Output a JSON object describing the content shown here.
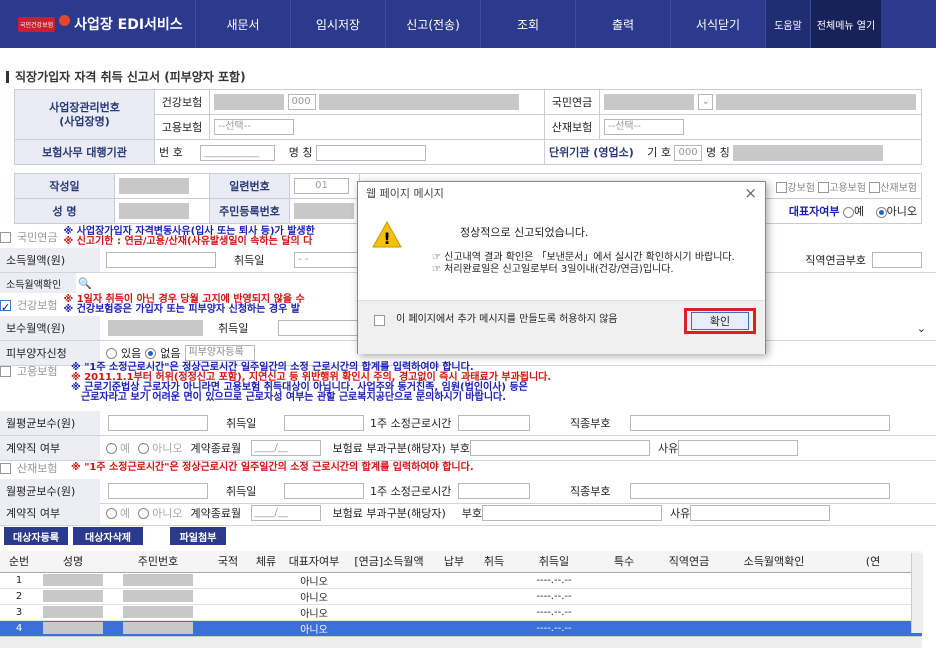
{
  "nav": {
    "logo_badge": "국민건강보험",
    "app_title": "사업장 EDI서비스",
    "menus": [
      "새문서",
      "임시저장",
      "신고(전송)",
      "조회",
      "출력",
      "서식닫기"
    ],
    "help": "도움말",
    "all_menu": "전체메뉴 열기"
  },
  "page_title": "직장가입자 자격 취득 신고서 (피부양자 포함)",
  "form": {
    "biz_no_label": "사업장관리번호\n(사업장명)",
    "health": "건강보험",
    "employ": "고용보험",
    "pension": "국민연금",
    "accident": "산재보험",
    "code_000": "000",
    "select_placeholder": "--선택--",
    "agency_label": "보험사무 대행기관",
    "num_label": "번 호",
    "name_label": "명 칭",
    "unit_label": "단위기관 (영업소)",
    "symbol_label": "기 호",
    "dash_line": "___________",
    "write_date": "작성일",
    "serial_no": "일련번호",
    "serial_val": "01",
    "name": "성 명",
    "resident_no": "주민등록번호",
    "rep_label": "대표자여부",
    "yes": "예",
    "no": "아니오",
    "partial_label_health": "강보험",
    "employ_chk": "고용보험",
    "accident_chk": "산재보험"
  },
  "pension_section": {
    "title": "국민연금",
    "note1": "※ 사업장가입자 자격변동사유(입사 또는 퇴사 등)가 발생한",
    "note2": "※ 신고기한 : 연금/고용/산재(사유발생일이 속하는 달의 다",
    "income_label": "소득월액(원)",
    "acq_date": "취득일",
    "dashes": "- -",
    "pension_code": "직역연금부호",
    "income_confirm": "소득월액확인"
  },
  "health_section": {
    "title": "건강보험",
    "note1": "※ 1일자 취득이 아닌 경우 당월 고지에 반영되지 않을 수",
    "note2": "※ 건강보험증은 가입자 또는 피부양자 신청하는 경우 발",
    "pay_label": "보수월액(원)",
    "acq_date": "취득일",
    "dependent_label": "피부양자신청",
    "has": "있음",
    "none": "없음",
    "dependent_btn": "피부양자등록"
  },
  "employ_section": {
    "title": "고용보험",
    "note1": "※ \"1주 소정근로시간\"은 정상근로시간 일주일간의  소정  근로시간의 합계를 입력하여야 합니다.",
    "note2": "※ 2011.1.1부터 허위(정정신고 포함), 지연신고 등 위반행위 확인시 주의, 경고없이 즉시 과태료가 부과됩니다.",
    "note3": "※ 근로기준법상 근로자가 아니라면 고용보험 취득대상이 아닙니다. 사업주와 동거친족, 임원(법인이사) 등은",
    "note4": "근로자라고 보기 어려운 면이 있으므로 근로자성 여부는 관할 근로복지공단으로 문의하시기 바랍니다.",
    "avg_pay": "월평균보수(원)",
    "acq_date": "취득일",
    "hours": "1주 소정근로시간",
    "job_code": "직종부호",
    "contract": "계약직 여부",
    "yes": "예",
    "no": "아니오",
    "contract_end": "계약종료월",
    "date_ph": "____/__",
    "exempt": "보험료 부과구분(해당자)",
    "code": "부호",
    "reason": "사유"
  },
  "accident_section": {
    "title": "산재보험",
    "note1": "※ \"1주 소정근로시간\"은 정상근로시간 일주일간의  소정  근로시간의 합계를 입력하여야 합니다.",
    "avg_pay": "월평균보수(원)",
    "acq_date": "취득일",
    "hours": "1주 소정근로시간",
    "job_code": "직종부호",
    "contract": "계약직 여부",
    "yes": "예",
    "no": "아니오",
    "contract_end": "계약종료월",
    "exempt": "보험료 부과구분(해당자)",
    "code": "부호",
    "reason": "사유"
  },
  "buttons": {
    "register": "대상자등록",
    "delete": "대상자삭제",
    "attach": "파일첨부"
  },
  "grid": {
    "columns": [
      "순번",
      "성명",
      "주민번호",
      "국적",
      "체류",
      "대표자여부",
      "[연금]소득월액",
      "납부",
      "취득",
      "취득일",
      "특수",
      "직역연금",
      "소득월액확인",
      "(연"
    ],
    "rows": [
      {
        "no": "1",
        "rep": "아니오",
        "date": "----.--.--"
      },
      {
        "no": "2",
        "rep": "아니오",
        "date": "----.--.--"
      },
      {
        "no": "3",
        "rep": "아니오",
        "date": "----.--.--"
      },
      {
        "no": "4",
        "rep": "아니오",
        "date": "----.--.--"
      }
    ]
  },
  "dialog": {
    "title": "웹 페이지 메시지",
    "close": "×",
    "message": "정상적으로 신고되었습니다.",
    "info1": "☞ 신고내역 결과 확인은 「보낸문서」에서 실시간 확인하시기 바랍니다.",
    "info2": "☞ 처리완료일은 신고일로부터 3일이내(건강/연금)입니다.",
    "checkbox_label": "이 페이지에서 추가 메시지를 만들도록 허용하지 않음",
    "ok": "확인",
    "highlight_color": "#e02020"
  }
}
